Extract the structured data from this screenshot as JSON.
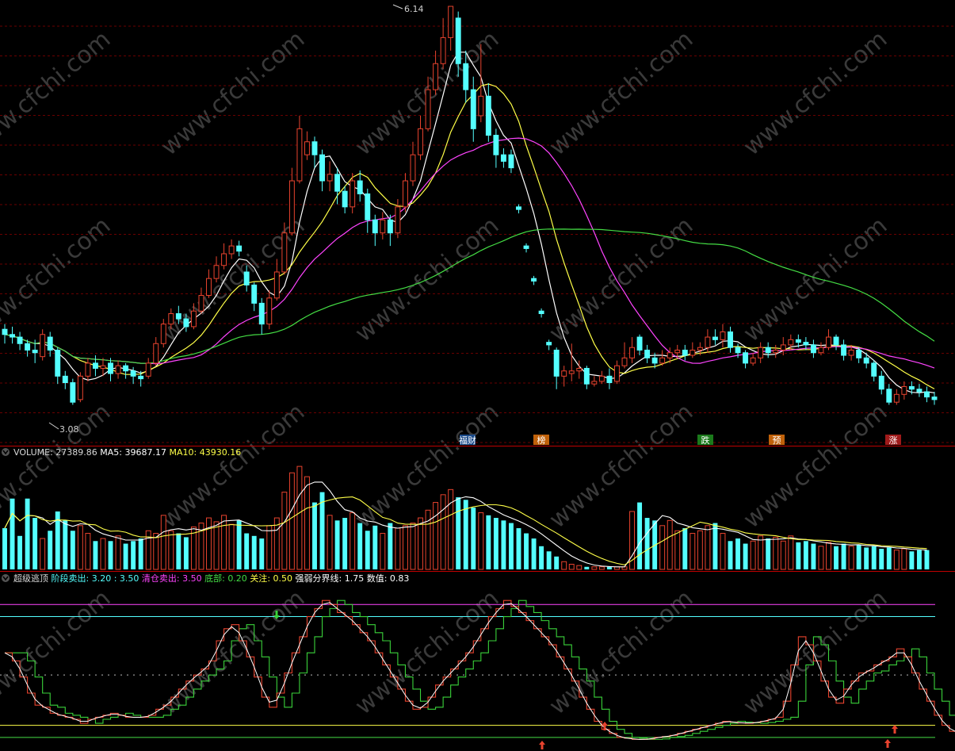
{
  "chart_data": [
    {
      "type": "candlestick",
      "panel": "price",
      "candles": [
        [
          3.66,
          3.62,
          3.7,
          3.55
        ],
        [
          3.62,
          3.6,
          3.68,
          3.55
        ],
        [
          3.6,
          3.55,
          3.64,
          3.5
        ],
        [
          3.55,
          3.5,
          3.58,
          3.45
        ],
        [
          3.5,
          3.48,
          3.58,
          3.4
        ],
        [
          3.45,
          3.62,
          3.66,
          3.42
        ],
        [
          3.6,
          3.5,
          3.64,
          3.45
        ],
        [
          3.5,
          3.3,
          3.52,
          3.24
        ],
        [
          3.3,
          3.25,
          3.34,
          3.2
        ],
        [
          3.25,
          3.1,
          3.28,
          3.08
        ],
        [
          3.12,
          3.3,
          3.33,
          3.1
        ],
        [
          3.3,
          3.4,
          3.44,
          3.26
        ],
        [
          3.4,
          3.36,
          3.46,
          3.3
        ],
        [
          3.36,
          3.38,
          3.44,
          3.3
        ],
        [
          3.4,
          3.32,
          3.44,
          3.26
        ],
        [
          3.32,
          3.38,
          3.42,
          3.28
        ],
        [
          3.38,
          3.34,
          3.4,
          3.28
        ],
        [
          3.34,
          3.3,
          3.37,
          3.24
        ],
        [
          3.3,
          3.28,
          3.34,
          3.22
        ],
        [
          3.3,
          3.4,
          3.44,
          3.28
        ],
        [
          3.4,
          3.55,
          3.6,
          3.38
        ],
        [
          3.55,
          3.7,
          3.74,
          3.52
        ],
        [
          3.7,
          3.78,
          3.82,
          3.66
        ],
        [
          3.78,
          3.74,
          3.84,
          3.7
        ],
        [
          3.74,
          3.68,
          3.78,
          3.64
        ],
        [
          3.68,
          3.8,
          3.86,
          3.66
        ],
        [
          3.8,
          3.92,
          3.98,
          3.78
        ],
        [
          3.92,
          4.05,
          4.12,
          3.9
        ],
        [
          4.05,
          4.15,
          4.22,
          4.02
        ],
        [
          4.15,
          4.24,
          4.32,
          4.12
        ],
        [
          4.24,
          4.3,
          4.35,
          4.2
        ],
        [
          4.3,
          4.26,
          4.34,
          4.22
        ],
        [
          4.1,
          4.0,
          4.15,
          3.95
        ],
        [
          4.0,
          3.86,
          4.02,
          3.8
        ],
        [
          3.86,
          3.7,
          3.9,
          3.62
        ],
        [
          3.7,
          3.9,
          3.96,
          3.66
        ],
        [
          3.9,
          4.1,
          4.2,
          3.88
        ],
        [
          4.1,
          4.4,
          4.48,
          4.08
        ],
        [
          4.4,
          4.8,
          4.9,
          4.38
        ],
        [
          4.8,
          5.2,
          5.3,
          4.78
        ],
        [
          5.0,
          5.1,
          5.18,
          4.96
        ],
        [
          5.1,
          5.0,
          5.14,
          4.9
        ],
        [
          5.0,
          4.8,
          5.04,
          4.72
        ],
        [
          4.8,
          4.85,
          4.95,
          4.72
        ],
        [
          4.85,
          4.72,
          4.9,
          4.62
        ],
        [
          4.72,
          4.6,
          4.76,
          4.55
        ],
        [
          4.6,
          4.8,
          4.86,
          4.55
        ],
        [
          4.8,
          4.7,
          4.88,
          4.64
        ],
        [
          4.7,
          4.5,
          4.74,
          4.4
        ],
        [
          4.5,
          4.4,
          4.54,
          4.3
        ],
        [
          4.4,
          4.5,
          4.56,
          4.35
        ],
        [
          4.5,
          4.4,
          4.54,
          4.3
        ],
        [
          4.4,
          4.6,
          4.66,
          4.36
        ],
        [
          4.6,
          4.8,
          4.86,
          4.56
        ],
        [
          4.8,
          5.0,
          5.1,
          4.76
        ],
        [
          5.0,
          5.2,
          5.3,
          4.96
        ],
        [
          5.2,
          5.5,
          5.6,
          5.18
        ],
        [
          5.5,
          5.7,
          5.8,
          5.46
        ],
        [
          5.7,
          5.9,
          6.05,
          5.66
        ],
        [
          5.9,
          6.14,
          6.14,
          5.8
        ],
        [
          6.05,
          5.7,
          6.1,
          5.6
        ],
        [
          5.7,
          5.5,
          5.8,
          5.4
        ],
        [
          5.5,
          5.2,
          5.6,
          5.1
        ],
        [
          5.3,
          5.45,
          5.85,
          5.25
        ],
        [
          5.45,
          5.15,
          5.55,
          5.1
        ],
        [
          5.15,
          5.0,
          5.2,
          4.9
        ],
        [
          5.0,
          4.95,
          5.05,
          4.9
        ],
        [
          5.0,
          4.9,
          5.04,
          4.86
        ],
        [
          4.6,
          4.58,
          4.62,
          4.55
        ],
        [
          4.3,
          4.28,
          4.32,
          4.25
        ],
        [
          4.05,
          4.03,
          4.07,
          4.0
        ],
        [
          3.8,
          3.78,
          3.82,
          3.75
        ],
        [
          3.56,
          3.54,
          3.58,
          3.5
        ],
        [
          3.5,
          3.3,
          3.52,
          3.2
        ],
        [
          3.3,
          3.34,
          3.38,
          3.22
        ],
        [
          3.32,
          3.34,
          3.55,
          3.26
        ],
        [
          3.34,
          3.36,
          3.42,
          3.28
        ],
        [
          3.36,
          3.24,
          3.38,
          3.2
        ],
        [
          3.24,
          3.26,
          3.3,
          3.22
        ],
        [
          3.26,
          3.3,
          3.34,
          3.24
        ],
        [
          3.3,
          3.25,
          3.36,
          3.2
        ],
        [
          3.26,
          3.38,
          3.42,
          3.24
        ],
        [
          3.38,
          3.44,
          3.56,
          3.36
        ],
        [
          3.44,
          3.52,
          3.6,
          3.4
        ],
        [
          3.6,
          3.5,
          3.62,
          3.46
        ],
        [
          3.5,
          3.44,
          3.54,
          3.4
        ],
        [
          3.44,
          3.4,
          3.48,
          3.36
        ],
        [
          3.4,
          3.44,
          3.5,
          3.38
        ],
        [
          3.44,
          3.48,
          3.52,
          3.4
        ],
        [
          3.48,
          3.5,
          3.54,
          3.44
        ],
        [
          3.5,
          3.46,
          3.54,
          3.42
        ],
        [
          3.46,
          3.5,
          3.56,
          3.44
        ],
        [
          3.5,
          3.52,
          3.56,
          3.46
        ],
        [
          3.52,
          3.6,
          3.66,
          3.48
        ],
        [
          3.6,
          3.58,
          3.66,
          3.54
        ],
        [
          3.58,
          3.64,
          3.7,
          3.52
        ],
        [
          3.64,
          3.52,
          3.68,
          3.48
        ],
        [
          3.52,
          3.48,
          3.55,
          3.44
        ],
        [
          3.48,
          3.4,
          3.5,
          3.36
        ],
        [
          3.4,
          3.44,
          3.48,
          3.38
        ],
        [
          3.44,
          3.52,
          3.56,
          3.4
        ],
        [
          3.52,
          3.48,
          3.56,
          3.44
        ],
        [
          3.48,
          3.5,
          3.54,
          3.44
        ],
        [
          3.5,
          3.54,
          3.6,
          3.46
        ],
        [
          3.54,
          3.58,
          3.62,
          3.5
        ],
        [
          3.58,
          3.56,
          3.62,
          3.52
        ],
        [
          3.56,
          3.54,
          3.6,
          3.5
        ],
        [
          3.54,
          3.48,
          3.58,
          3.44
        ],
        [
          3.48,
          3.52,
          3.56,
          3.46
        ],
        [
          3.52,
          3.6,
          3.66,
          3.5
        ],
        [
          3.6,
          3.54,
          3.62,
          3.5
        ],
        [
          3.54,
          3.46,
          3.58,
          3.42
        ],
        [
          3.46,
          3.5,
          3.54,
          3.42
        ],
        [
          3.5,
          3.44,
          3.52,
          3.4
        ],
        [
          3.44,
          3.4,
          3.48,
          3.36
        ],
        [
          3.4,
          3.3,
          3.42,
          3.26
        ],
        [
          3.3,
          3.2,
          3.34,
          3.16
        ],
        [
          3.2,
          3.1,
          3.24,
          3.08
        ],
        [
          3.1,
          3.16,
          3.2,
          3.08
        ],
        [
          3.16,
          3.22,
          3.26,
          3.12
        ],
        [
          3.22,
          3.2,
          3.26,
          3.16
        ],
        [
          3.2,
          3.18,
          3.24,
          3.14
        ],
        [
          3.18,
          3.14,
          3.22,
          3.1
        ],
        [
          3.14,
          3.12,
          3.18,
          3.08
        ]
      ],
      "candle_format": [
        "open",
        "close",
        "high",
        "low"
      ],
      "price_range": [
        2.9,
        6.14
      ],
      "annotations": {
        "high": "6.14",
        "low": "3.08"
      },
      "events": [
        "福财",
        "榜",
        "跌",
        "预",
        "涨"
      ],
      "moving_averages": [
        "MA5",
        "MA10",
        "MA20",
        "MA60"
      ],
      "colors": {
        "up": "#e8432e",
        "down": "#54ffff",
        "ma5": "#ffffff",
        "ma10": "#ffff48",
        "ma20": "#ff44ff",
        "ma60": "#44dd44",
        "grid": "#6a0000"
      }
    },
    {
      "type": "bar",
      "panel": "volume",
      "values": [
        32000,
        55000,
        26000,
        55000,
        40000,
        24000,
        30000,
        45000,
        38000,
        30000,
        34000,
        28000,
        22000,
        24000,
        22000,
        26000,
        20000,
        22000,
        24000,
        30000,
        28000,
        42000,
        30000,
        28000,
        25000,
        33000,
        36000,
        40000,
        37000,
        42000,
        35000,
        38000,
        28000,
        26000,
        24000,
        34000,
        40000,
        60000,
        75000,
        80000,
        72000,
        52000,
        60000,
        42000,
        38000,
        40000,
        44000,
        36000,
        30000,
        34000,
        28000,
        36000,
        32000,
        34000,
        36000,
        40000,
        46000,
        52000,
        58000,
        62000,
        56000,
        54000,
        48000,
        44000,
        42000,
        40000,
        38000,
        36000,
        32000,
        28000,
        24000,
        18000,
        14000,
        10000,
        6000,
        4000,
        3000,
        2000,
        2000,
        2000,
        2000,
        2000,
        2000,
        45000,
        52000,
        40000,
        38000,
        34000,
        38000,
        30000,
        32000,
        28000,
        30000,
        34000,
        36000,
        28000,
        22000,
        24000,
        20000,
        22000,
        26000,
        24000,
        25000,
        22000,
        26000,
        21000,
        22000,
        20000,
        18000,
        21000,
        18000,
        20000,
        18000,
        19000,
        17000,
        18000,
        16000,
        17000,
        15000,
        16000,
        14000,
        15000,
        15000
      ],
      "legend": {
        "label": "VOLUME",
        "value": "27389.86",
        "ma5_label": "MA5",
        "ma5_value": "39687.17",
        "ma10_label": "MA10",
        "ma10_value": "43930.16"
      },
      "colors": {
        "up": "#e8432e",
        "down": "#54ffff",
        "ma5": "#ffffff",
        "ma10": "#ffff48"
      }
    },
    {
      "type": "line",
      "panel": "indicator",
      "title": "超级逃顶",
      "legend": [
        {
          "label": "阶段卖出",
          "values": [
            "3.20",
            "3.50"
          ],
          "color": "#54ffff"
        },
        {
          "label": "清仓卖出",
          "values": [
            "3.50"
          ],
          "color": "#ff44ff"
        },
        {
          "label": "底部",
          "values": [
            "0.20"
          ],
          "color": "#44dd44"
        },
        {
          "label": "关注",
          "values": [
            "0.50"
          ],
          "color": "#ffff48"
        },
        {
          "label": "强弱分界线",
          "values": [
            "1.75"
          ],
          "color": "#ffffff"
        },
        {
          "label": "数值",
          "values": [
            "0.83"
          ],
          "color": "#ffffff"
        }
      ],
      "reference_lines": [
        3.2,
        3.5,
        1.75,
        0.5,
        0.2
      ],
      "values": [
        2.3,
        2.1,
        1.7,
        1.3,
        1.0,
        0.95,
        0.8,
        0.75,
        0.7,
        0.65,
        0.55,
        0.65,
        0.7,
        0.75,
        0.8,
        0.75,
        0.7,
        0.7,
        0.7,
        0.75,
        0.9,
        1.0,
        1.2,
        1.4,
        1.6,
        1.75,
        1.9,
        2.1,
        2.6,
        2.9,
        3.0,
        2.6,
        2.2,
        1.7,
        1.2,
        0.95,
        1.3,
        1.8,
        2.3,
        2.7,
        3.2,
        3.4,
        3.6,
        3.5,
        3.3,
        3.2,
        3.0,
        2.8,
        2.6,
        2.3,
        2.0,
        1.7,
        1.4,
        1.1,
        0.9,
        0.95,
        1.2,
        1.5,
        1.7,
        1.9,
        2.1,
        2.3,
        2.6,
        2.9,
        3.2,
        3.4,
        3.6,
        3.45,
        3.3,
        3.1,
        2.9,
        2.7,
        2.5,
        2.2,
        1.9,
        1.6,
        1.2,
        0.9,
        0.6,
        0.4,
        0.3,
        0.2,
        0.18,
        0.15,
        0.15,
        0.16,
        0.2,
        0.22,
        0.25,
        0.3,
        0.35,
        0.4,
        0.45,
        0.5,
        0.55,
        0.6,
        0.58,
        0.56,
        0.55,
        0.57,
        0.6,
        0.65,
        0.7,
        1.1,
        2.0,
        2.7,
        2.5,
        2.1,
        1.6,
        1.2,
        1.05,
        1.4,
        1.6,
        1.8,
        1.85,
        2.0,
        2.1,
        2.2,
        2.4,
        2.2,
        1.8,
        1.4,
        1.1,
        0.75,
        0.5,
        0.35,
        0.3,
        0.6,
        0.9,
        1.1,
        1.2,
        1.1,
        1.05
      ]
    }
  ]
}
